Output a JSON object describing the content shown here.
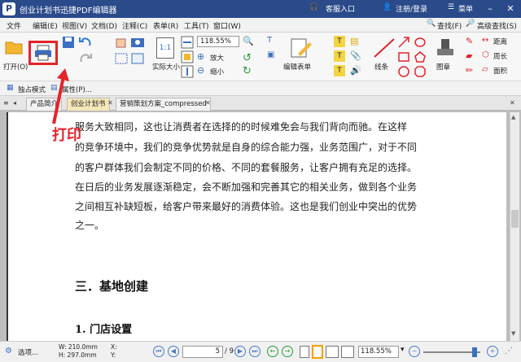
{
  "titlebar": {
    "app_title": "创业计划书迅捷PDF编辑器",
    "login_entry": "客服入口",
    "register": "注册/登录",
    "menu": "菜单"
  },
  "menubar": {
    "items": [
      "文件",
      "编辑(E)",
      "视图(V)",
      "文档(D)",
      "注释(C)",
      "表单(R)",
      "工具(T)",
      "窗口(W)"
    ],
    "search_label": "查找(F)",
    "advanced_search_label": "高级查找(S)"
  },
  "ribbon": {
    "open_label": "打开(O)",
    "actual_size_label": "实际大小",
    "zoom_value": "118.55%",
    "zoom_in_label": "放大",
    "zoom_out_label": "缩小",
    "edit_form_label": "编辑表单",
    "line_label": "线条",
    "stamp_label": "图章",
    "distance_label": "距离",
    "perimeter_label": "周长",
    "area_label": "面积"
  },
  "toolbar2": {
    "exclusive_mode_label": "独占模式",
    "properties_label": "属性(P)..."
  },
  "tabs": [
    {
      "label": "产品简介"
    },
    {
      "label": "创业计划书"
    },
    {
      "label": "营销策划方案_compressed"
    }
  ],
  "document": {
    "lines": [
      "服务大致相同，这也让消费者在选择的的时候难免会与我们背向而驰。在这样",
      "的竞争环境中，我们的竞争优势就是自身的综合能力强，业务范围广，对于不同",
      "的客户群体我们会制定不同的价格、不同的套餐服务，让客户拥有充足的选择。",
      "在日后的业务发展逐渐稳定，会不断加强和完善其它的相关业务，做到各个业务",
      "之间相互补缺短板，给客户带来最好的消费体验。这也是我们创业中突出的优势",
      "之一。"
    ],
    "heading": "三．基地创建",
    "subheading": "1. 门店设置"
  },
  "annotation": {
    "label": "打印",
    "color": "#e5232a"
  },
  "status": {
    "options_label": "选项...",
    "width": "W: 210.0mm",
    "height": "H: 297.0mm",
    "x_label": "X:",
    "y_label": "Y:",
    "page_current": "5",
    "page_total": "/ 9",
    "zoom_value": "118.55%"
  }
}
